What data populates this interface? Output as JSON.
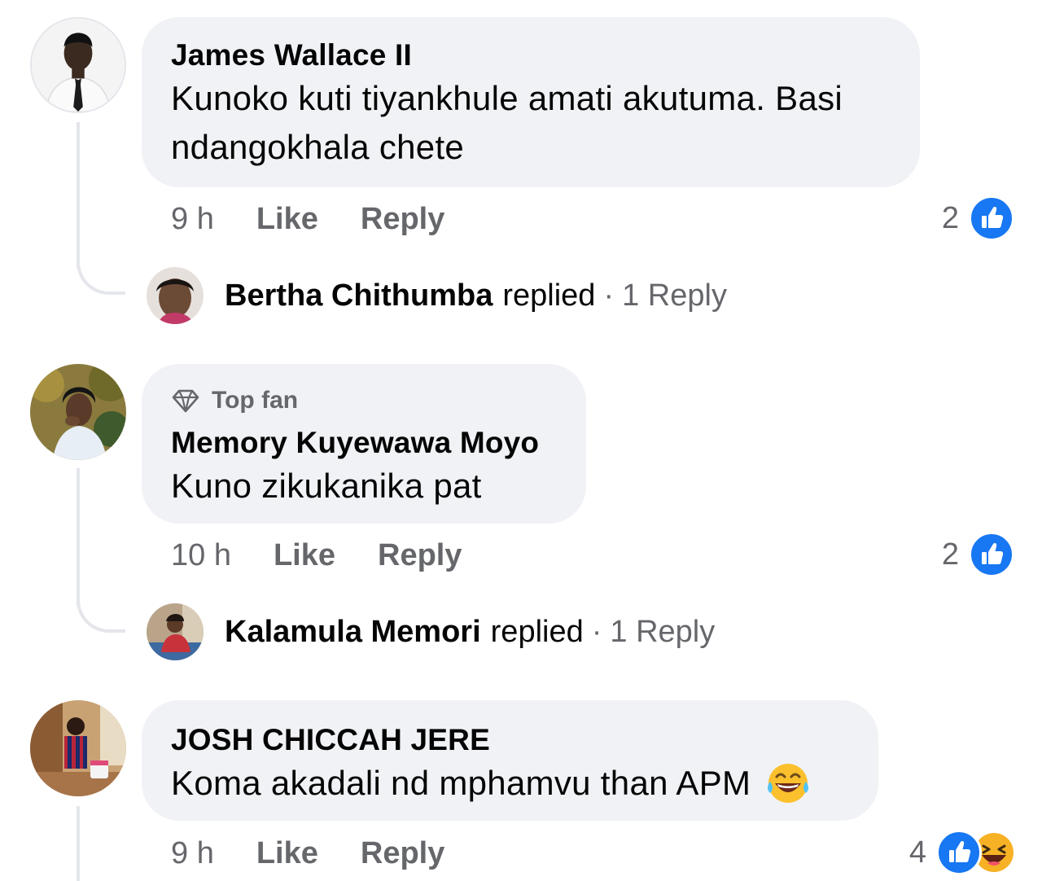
{
  "comments": [
    {
      "author": "James Wallace II",
      "text": "Kunoko kuti tiyankhule amati akutuma. Basi ndangokhala chete",
      "time": "9 h",
      "like_label": "Like",
      "reply_label": "Reply",
      "reaction_count": "2",
      "reactions": [
        "like-icon"
      ],
      "reply_summary": {
        "name": "Bertha Chithumba",
        "verb": "replied",
        "separator": "·",
        "count_label": "1 Reply"
      }
    },
    {
      "badge": "Top fan",
      "badge_icon": "diamond-icon",
      "author": "Memory Kuyewawa Moyo",
      "text": "Kuno zikukanika pat",
      "time": "10 h",
      "like_label": "Like",
      "reply_label": "Reply",
      "reaction_count": "2",
      "reactions": [
        "like-icon"
      ],
      "reply_summary": {
        "name": "Kalamula Memori",
        "verb": "replied",
        "separator": "·",
        "count_label": "1 Reply"
      }
    },
    {
      "author": "JOSH CHICCAH JERE",
      "text": "Koma akadali nd mphamvu than APM",
      "text_emoji": "laughing-tears-emoji",
      "time": "9 h",
      "like_label": "Like",
      "reply_label": "Reply",
      "reaction_count": "4",
      "reactions": [
        "like-icon",
        "haha-icon"
      ]
    }
  ],
  "colors": {
    "bubble": "#f0f2f5",
    "meta_text": "#65676b",
    "like_blue": "#1877f2",
    "haha_yellow": "#f7b125",
    "thread_line": "#e4e6eb"
  }
}
